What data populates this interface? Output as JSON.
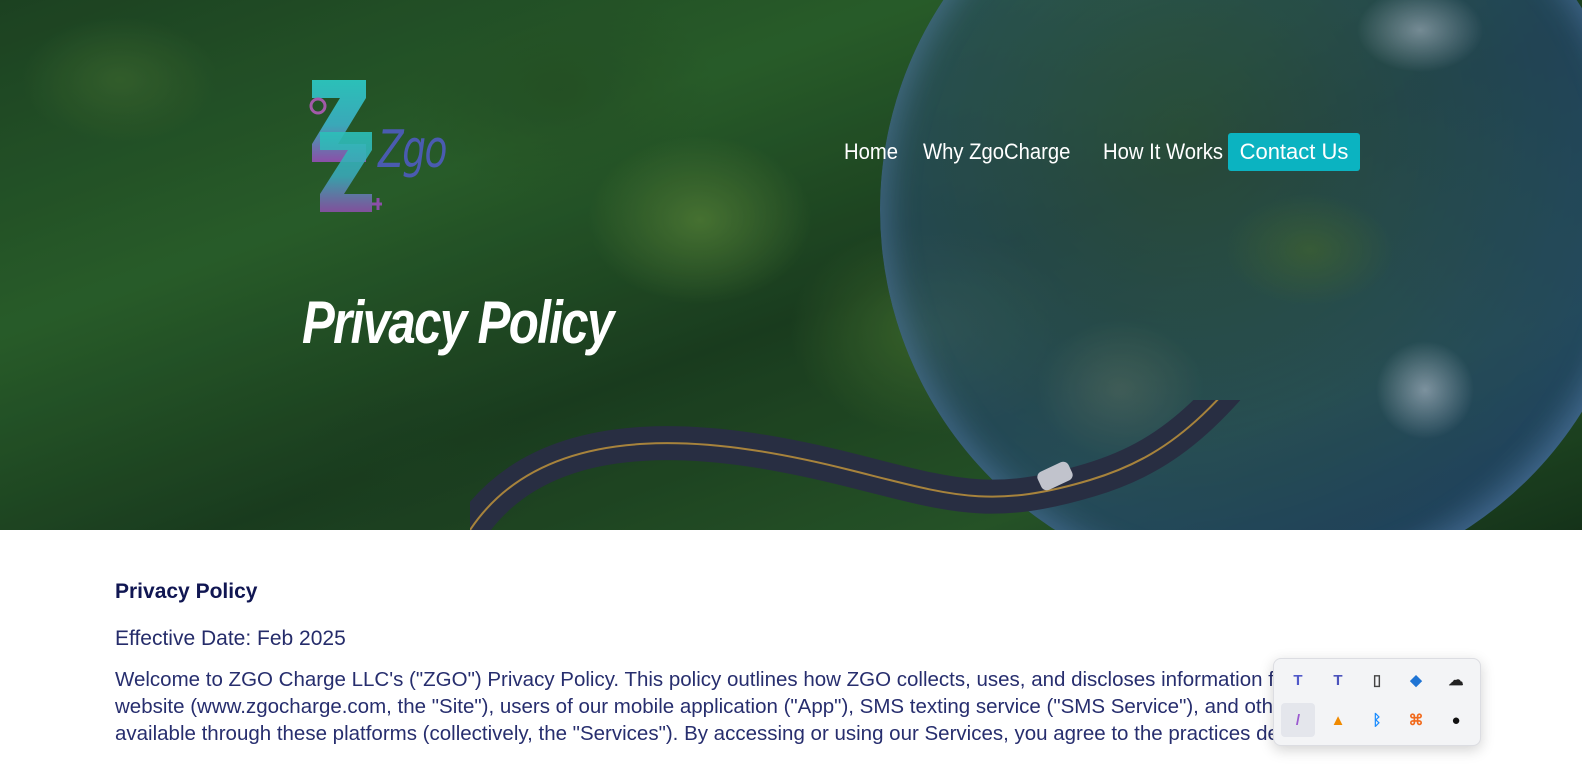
{
  "brand": {
    "name": "Zgo",
    "logo_mark": "Z"
  },
  "nav": {
    "items": [
      {
        "label": "Home"
      },
      {
        "label": "Why ZgoCharge"
      },
      {
        "label": "How It Works"
      }
    ],
    "cta_label": "Contact Us"
  },
  "hero": {
    "title": "Privacy Policy"
  },
  "content": {
    "heading": "Privacy Policy",
    "effective_date": "Effective Date: Feb 2025",
    "intro": "Welcome to ZGO Charge LLC's (\"ZGO\") Privacy Policy. This policy outlines how ZGO collects, uses, and discloses information from visitors to our website (www.zgocharge.com, the \"Site\"), users of our mobile application (\"App\"), SMS texting service (\"SMS Service\"), and other services available through these platforms (collectively, the \"Services\"). By accessing or using our Services, you agree to the practices described in this"
  },
  "tray": {
    "icons": [
      {
        "name": "teams-icon",
        "glyph": "T",
        "color": "#5059c9"
      },
      {
        "name": "teams-classic-icon",
        "glyph": "T",
        "color": "#4b53bc"
      },
      {
        "name": "usb-drive-icon",
        "glyph": "▯",
        "color": "#444444"
      },
      {
        "name": "defender-warning-icon",
        "glyph": "◆",
        "color": "#1f74d4"
      },
      {
        "name": "onedrive-offline-icon",
        "glyph": "☁",
        "color": "#222222"
      },
      {
        "name": "feather-pen-icon",
        "glyph": "/",
        "color": "#9b59d0"
      },
      {
        "name": "vlc-cone-icon",
        "glyph": "▲",
        "color": "#f08a00"
      },
      {
        "name": "bluetooth-icon",
        "glyph": "ᛒ",
        "color": "#1a8cff"
      },
      {
        "name": "xampp-icon",
        "glyph": "⌘",
        "color": "#f16a1c"
      },
      {
        "name": "circle-badge-icon",
        "glyph": "●",
        "color": "#111111"
      }
    ]
  }
}
